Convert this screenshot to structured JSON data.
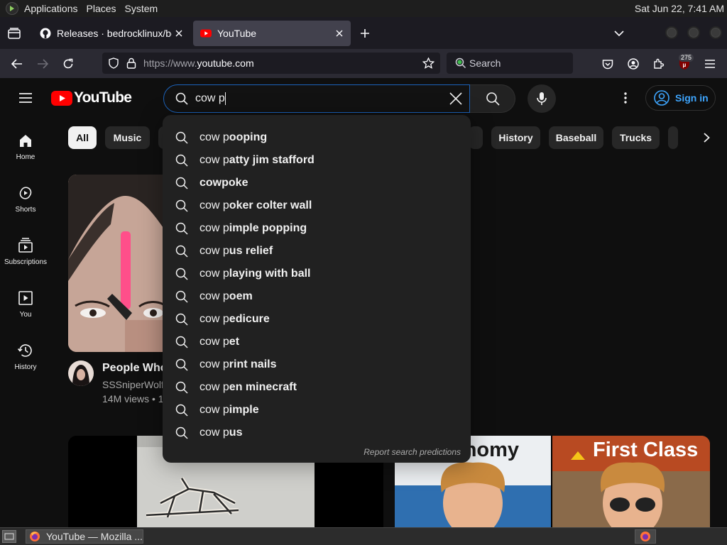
{
  "panel": {
    "menus": [
      "Applications",
      "Places",
      "System"
    ],
    "clock": "Sat Jun 22,  7:41 AM"
  },
  "tabs": [
    {
      "title": "Releases · bedrocklinux/bedrock-linux",
      "active": false,
      "icon": "github-icon"
    },
    {
      "title": "YouTube",
      "active": true,
      "icon": "youtube-favicon"
    }
  ],
  "urlbar": {
    "protocol": "https://www.",
    "host": "youtube.com"
  },
  "ff_search": {
    "placeholder": "Search"
  },
  "extension_badge": "275",
  "youtube": {
    "logo": "YouTube",
    "search_query": "cow p",
    "sign_in": "Sign in",
    "guide": [
      "Home",
      "Shorts",
      "Subscriptions",
      "You",
      "History"
    ],
    "chips": [
      "All",
      "Music",
      "History",
      "Baseball",
      "Trucks"
    ],
    "suggestions": [
      {
        "prefix": "cow p",
        "rest": "ooping"
      },
      {
        "prefix": "cow p",
        "rest": "atty jim stafford"
      },
      {
        "prefix": "",
        "rest": "cowpoke"
      },
      {
        "prefix": "cow p",
        "rest": "oker colter wall"
      },
      {
        "prefix": "cow p",
        "rest": "imple popping"
      },
      {
        "prefix": "cow p",
        "rest": "us relief"
      },
      {
        "prefix": "cow p",
        "rest": "laying with ball"
      },
      {
        "prefix": "cow p",
        "rest": "oem"
      },
      {
        "prefix": "cow p",
        "rest": "edicure"
      },
      {
        "prefix": "cow p",
        "rest": "et"
      },
      {
        "prefix": "cow p",
        "rest": "rint nails"
      },
      {
        "prefix": "cow p",
        "rest": "en minecraft"
      },
      {
        "prefix": "cow p",
        "rest": "imple"
      },
      {
        "prefix": "cow p",
        "rest": "us"
      }
    ],
    "report": "Report search predictions",
    "video": {
      "title": "People Who",
      "channel": "SSSniperWolf",
      "meta": "14M views • 1"
    },
    "thumb_texts": [
      "onomy",
      "First Class"
    ]
  },
  "taskbar": {
    "window_title": "YouTube — Mozilla ..."
  },
  "colors": {
    "yt_red": "#ff0000",
    "link_blue": "#3ea6ff",
    "focus_border": "#1c62b9"
  }
}
